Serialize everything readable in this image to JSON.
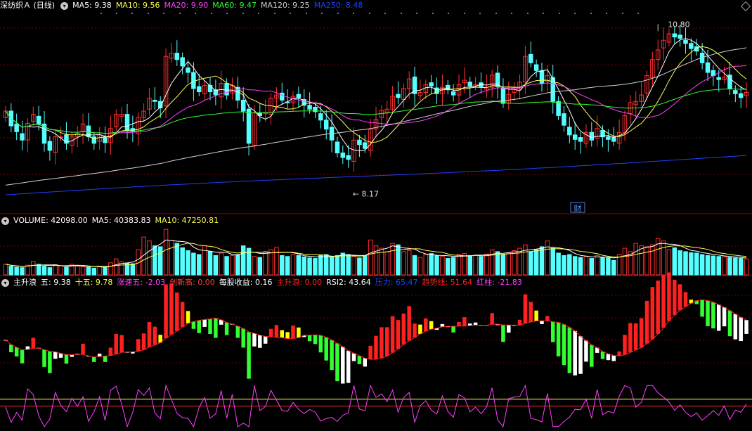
{
  "colors": {
    "up": "#ff3030",
    "down": "#54ffff",
    "ma5": "#ffffff",
    "ma10": "#ffff50",
    "ma20": "#ff40ff",
    "ma60": "#30ff30",
    "ma120": "#d0d0d0",
    "ma250": "#2040ff",
    "grid": "#700000",
    "sep": "#a00000"
  },
  "main": {
    "title": "深纺织Ａ (日线)",
    "ma": [
      {
        "label": "MA5:",
        "value": "9.38",
        "color": "#ffffff"
      },
      {
        "label": "MA10:",
        "value": "9.56",
        "color": "#ffff50"
      },
      {
        "label": "MA20:",
        "value": "9.90",
        "color": "#ff40ff"
      },
      {
        "label": "MA60:",
        "value": "9.47",
        "color": "#30ff30"
      },
      {
        "label": "MA120:",
        "value": "9.25",
        "color": "#d0d0d0"
      },
      {
        "label": "MA250:",
        "value": "8.48",
        "color": "#2040ff"
      }
    ],
    "high_label": "10.80",
    "low_label": "8.17",
    "finance_badge": "财"
  },
  "volume": {
    "items": [
      {
        "label": "VOLUME:",
        "value": "42098.00",
        "color": "#ffffff"
      },
      {
        "label": "MA5:",
        "value": "40383.83",
        "color": "#ffffff"
      },
      {
        "label": "MA10:",
        "value": "47250.81",
        "color": "#ffff50"
      }
    ]
  },
  "indicator": {
    "name": "主升浪",
    "items": [
      {
        "label": "五:",
        "value": "9.38",
        "color": "#ffffff"
      },
      {
        "label": "十五:",
        "value": "9.78",
        "color": "#ffff50"
      },
      {
        "label": "涨速五:",
        "value": "-2.03",
        "color": "#ff40ff"
      },
      {
        "label": "创新高:",
        "value": "0.00",
        "color": "#ff4040"
      },
      {
        "label": "每股收益:",
        "value": "0.16",
        "color": "#ffffff"
      },
      {
        "label": "主升浪:",
        "value": "0.00",
        "color": "#ff2020"
      },
      {
        "label": "RSI2:",
        "value": "43.64",
        "color": "#ffffff"
      },
      {
        "label": "压力:",
        "value": "65.47",
        "color": "#2040ff"
      },
      {
        "label": "趋势线:",
        "value": "51.64",
        "color": "#ff2020"
      },
      {
        "label": "红柱:",
        "value": "-21.83",
        "color": "#ff40ff"
      }
    ]
  },
  "chart_data": {
    "type": "candlestick",
    "y_range": [
      7.9,
      11.0
    ],
    "closes": [
      9.45,
      9.22,
      9.13,
      9.0,
      9.26,
      9.4,
      9.25,
      8.95,
      8.84,
      9.05,
      9.05,
      8.95,
      9.05,
      9.1,
      9.25,
      9.05,
      8.95,
      9.08,
      8.96,
      9.18,
      9.4,
      9.4,
      9.15,
      9.13,
      9.35,
      9.45,
      9.65,
      9.6,
      9.5,
      10.3,
      10.35,
      10.25,
      10.15,
      10.05,
      9.8,
      9.75,
      9.85,
      9.75,
      9.7,
      9.88,
      9.7,
      9.85,
      9.62,
      9.45,
      8.95,
      9.42,
      9.38,
      9.43,
      9.65,
      9.7,
      9.62,
      9.58,
      9.68,
      9.66,
      9.54,
      9.48,
      9.44,
      9.31,
      9.17,
      9.0,
      8.8,
      8.73,
      8.7,
      9.0,
      8.93,
      8.87,
      9.17,
      9.32,
      9.46,
      9.48,
      9.68,
      9.66,
      9.8,
      9.95,
      9.72,
      9.74,
      9.86,
      9.84,
      9.72,
      9.82,
      9.78,
      9.7,
      9.86,
      9.93,
      9.84,
      9.86,
      9.82,
      9.82,
      10.01,
      9.83,
      9.57,
      9.71,
      9.82,
      9.9,
      10.3,
      10.2,
      10.08,
      9.88,
      10.0,
      9.6,
      9.38,
      9.23,
      9.08,
      9.01,
      8.98,
      9.12,
      9.0,
      9.18,
      9.05,
      9.01,
      8.98,
      9.12,
      9.38,
      9.58,
      9.6,
      9.7,
      10.0,
      10.25,
      10.4,
      10.55,
      10.65,
      10.6,
      10.58,
      10.5,
      10.42,
      10.38,
      10.2,
      10.05,
      10.0,
      9.94,
      9.98,
      9.8,
      9.72,
      9.66,
      9.74
    ],
    "volumes": [
      22000,
      18000,
      16000,
      15000,
      20000,
      28000,
      22000,
      18000,
      15000,
      21000,
      19000,
      16000,
      22000,
      18000,
      17000,
      16000,
      14000,
      18000,
      15000,
      25000,
      33000,
      27000,
      24000,
      23000,
      52000,
      78000,
      70000,
      60000,
      58000,
      94000,
      71000,
      65000,
      56000,
      50000,
      45000,
      42000,
      60000,
      48000,
      40000,
      45000,
      38000,
      40000,
      42000,
      60000,
      55000,
      38000,
      36000,
      48000,
      52000,
      56000,
      40000,
      38000,
      42000,
      40000,
      37000,
      35000,
      34000,
      40000,
      42000,
      38000,
      40000,
      45000,
      42000,
      38000,
      35000,
      40000,
      72000,
      60000,
      55000,
      48000,
      65000,
      62000,
      48000,
      50000,
      40000,
      36000,
      42000,
      44000,
      40000,
      38000,
      34000,
      36000,
      42000,
      44000,
      40000,
      41000,
      38000,
      43000,
      52000,
      48000,
      42000,
      45000,
      50000,
      55000,
      62000,
      48000,
      52000,
      58000,
      70000,
      55000,
      45000,
      40000,
      42000,
      38000,
      36000,
      38000,
      34000,
      40000,
      36000,
      35000,
      30000,
      42000,
      55000,
      48000,
      65000,
      60000,
      58000,
      62000,
      75000,
      70000,
      52000,
      56000,
      50000,
      48000,
      46000,
      45000,
      42000,
      40000,
      39000,
      38000,
      37000,
      36000,
      35000,
      34000,
      33000
    ],
    "ma120_start": 8.3,
    "ma250_start": 8.15
  }
}
